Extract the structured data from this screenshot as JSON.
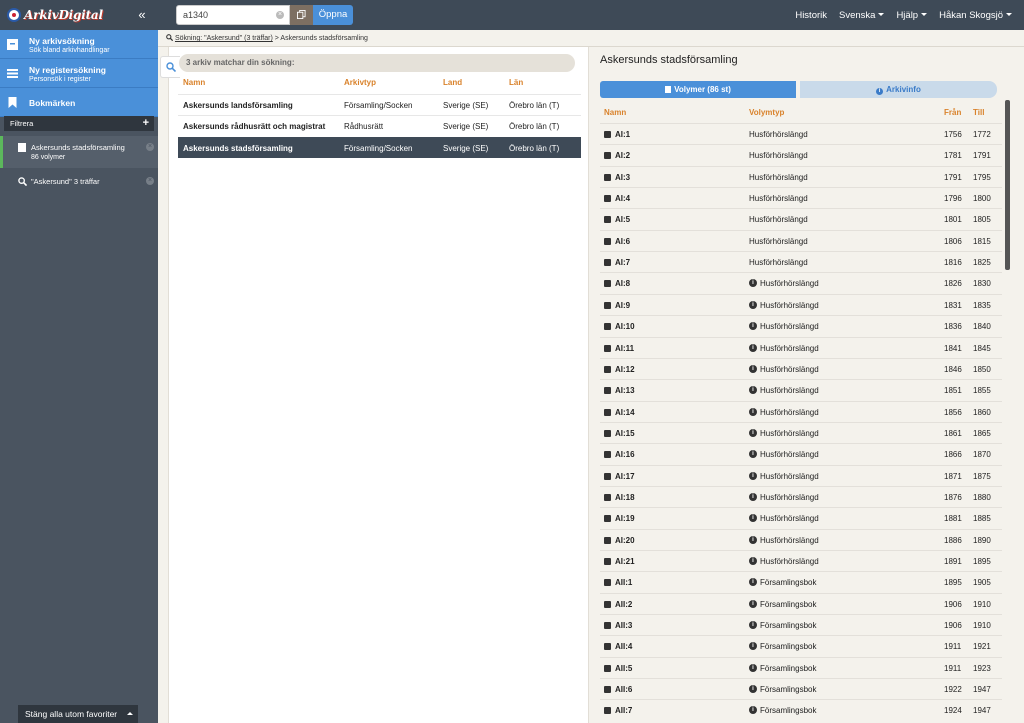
{
  "topbar": {
    "logo_text": "ArkivDigital",
    "search_value": "a1340",
    "open_label": "Öppna",
    "nav": [
      "Historik",
      "Svenska",
      "Hjälp",
      "Håkan Skogsjö"
    ]
  },
  "sidebar": {
    "main": [
      {
        "title": "Ny arkivsökning",
        "sub": "Sök bland arkivhandlingar"
      },
      {
        "title": "Ny registersökning",
        "sub": "Personsök i register"
      },
      {
        "title": "Bokmärken",
        "sub": ""
      }
    ],
    "filter_label": "Filtrera",
    "items": [
      {
        "title": "Askersunds stadsförsamling",
        "sub": "86 volymer"
      },
      {
        "title": "\"Askersund\"",
        "sub": "3 träffar"
      }
    ],
    "close_all_label": "Stäng alla utom favoriter"
  },
  "breadcrumb": {
    "link": "Sökning: \"Askersund\" (3 träffar)",
    "sep": ">",
    "current": "Askersunds stadsförsamling"
  },
  "results": {
    "match_text": "3 arkiv matchar din sökning:",
    "headers": [
      "Namn",
      "Arkivtyp",
      "Land",
      "Län"
    ],
    "rows": [
      {
        "name": "Askersunds landsförsamling",
        "type": "Församling/Socken",
        "country": "Sverige (SE)",
        "county": "Örebro län (T)"
      },
      {
        "name": "Askersunds rådhusrätt och magistrat",
        "type": "Rådhusrätt",
        "country": "Sverige (SE)",
        "county": "Örebro län (T)"
      },
      {
        "name": "Askersunds stadsförsamling",
        "type": "Församling/Socken",
        "country": "Sverige (SE)",
        "county": "Örebro län (T)"
      }
    ],
    "selected_index": 2
  },
  "detail": {
    "title": "Askersunds stadsförsamling",
    "tab_volumes": "Volymer (86 st)",
    "tab_info": "Arkivinfo",
    "headers": [
      "Namn",
      "Volymtyp",
      "Från",
      "Till"
    ],
    "rows": [
      {
        "name": "AI:1",
        "type": "Husförhörslängd",
        "info": false,
        "from": "1756",
        "to": "1772"
      },
      {
        "name": "AI:2",
        "type": "Husförhörslängd",
        "info": false,
        "from": "1781",
        "to": "1791"
      },
      {
        "name": "AI:3",
        "type": "Husförhörslängd",
        "info": false,
        "from": "1791",
        "to": "1795"
      },
      {
        "name": "AI:4",
        "type": "Husförhörslängd",
        "info": false,
        "from": "1796",
        "to": "1800"
      },
      {
        "name": "AI:5",
        "type": "Husförhörslängd",
        "info": false,
        "from": "1801",
        "to": "1805"
      },
      {
        "name": "AI:6",
        "type": "Husförhörslängd",
        "info": false,
        "from": "1806",
        "to": "1815"
      },
      {
        "name": "AI:7",
        "type": "Husförhörslängd",
        "info": false,
        "from": "1816",
        "to": "1825"
      },
      {
        "name": "AI:8",
        "type": "Husförhörslängd",
        "info": true,
        "from": "1826",
        "to": "1830"
      },
      {
        "name": "AI:9",
        "type": "Husförhörslängd",
        "info": true,
        "from": "1831",
        "to": "1835"
      },
      {
        "name": "AI:10",
        "type": "Husförhörslängd",
        "info": true,
        "from": "1836",
        "to": "1840"
      },
      {
        "name": "AI:11",
        "type": "Husförhörslängd",
        "info": true,
        "from": "1841",
        "to": "1845"
      },
      {
        "name": "AI:12",
        "type": "Husförhörslängd",
        "info": true,
        "from": "1846",
        "to": "1850"
      },
      {
        "name": "AI:13",
        "type": "Husförhörslängd",
        "info": true,
        "from": "1851",
        "to": "1855"
      },
      {
        "name": "AI:14",
        "type": "Husförhörslängd",
        "info": true,
        "from": "1856",
        "to": "1860"
      },
      {
        "name": "AI:15",
        "type": "Husförhörslängd",
        "info": true,
        "from": "1861",
        "to": "1865"
      },
      {
        "name": "AI:16",
        "type": "Husförhörslängd",
        "info": true,
        "from": "1866",
        "to": "1870"
      },
      {
        "name": "AI:17",
        "type": "Husförhörslängd",
        "info": true,
        "from": "1871",
        "to": "1875"
      },
      {
        "name": "AI:18",
        "type": "Husförhörslängd",
        "info": true,
        "from": "1876",
        "to": "1880"
      },
      {
        "name": "AI:19",
        "type": "Husförhörslängd",
        "info": true,
        "from": "1881",
        "to": "1885"
      },
      {
        "name": "AI:20",
        "type": "Husförhörslängd",
        "info": true,
        "from": "1886",
        "to": "1890"
      },
      {
        "name": "AI:21",
        "type": "Husförhörslängd",
        "info": true,
        "from": "1891",
        "to": "1895"
      },
      {
        "name": "AII:1",
        "type": "Församlingsbok",
        "info": true,
        "from": "1895",
        "to": "1905"
      },
      {
        "name": "AII:2",
        "type": "Församlingsbok",
        "info": true,
        "from": "1906",
        "to": "1910"
      },
      {
        "name": "AII:3",
        "type": "Församlingsbok",
        "info": true,
        "from": "1906",
        "to": "1910"
      },
      {
        "name": "AII:4",
        "type": "Församlingsbok",
        "info": true,
        "from": "1911",
        "to": "1921"
      },
      {
        "name": "AII:5",
        "type": "Församlingsbok",
        "info": true,
        "from": "1911",
        "to": "1923"
      },
      {
        "name": "AII:6",
        "type": "Församlingsbok",
        "info": true,
        "from": "1922",
        "to": "1947"
      },
      {
        "name": "AII:7",
        "type": "Församlingsbok",
        "info": true,
        "from": "1924",
        "to": "1947"
      }
    ]
  },
  "colors": {
    "accent": "#4a90d9",
    "header_text": "#d9822b",
    "topbar": "#3e4a57",
    "sidebar": "#4a5460",
    "selected_row": "#3e4a57"
  },
  "icons": [
    "archive-icon",
    "menu-icon",
    "bookmark-icon",
    "plus-icon",
    "search-icon",
    "clear-icon",
    "copy-icon",
    "book-icon",
    "info-icon",
    "chevron-double-left-icon"
  ]
}
